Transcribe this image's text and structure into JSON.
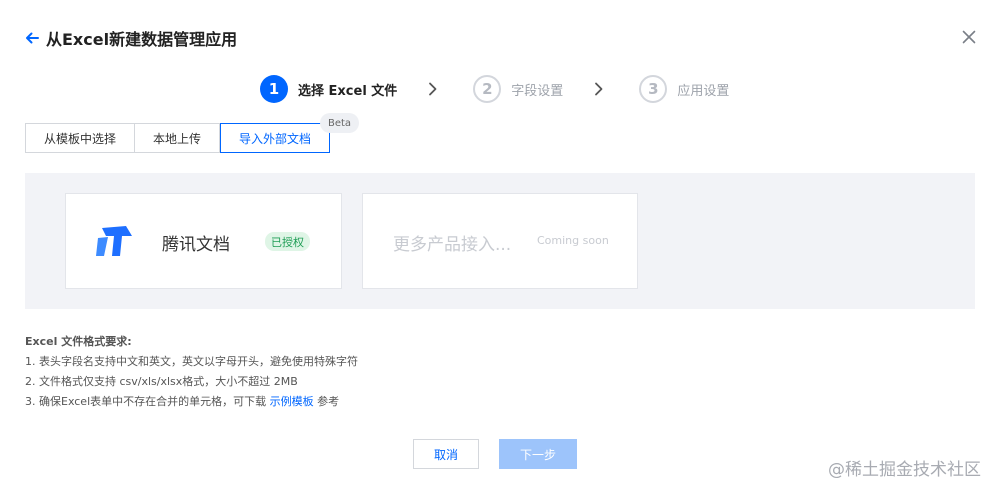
{
  "header": {
    "title": "从Excel新建数据管理应用"
  },
  "steps": [
    {
      "num": "1",
      "label": "选择 Excel 文件"
    },
    {
      "num": "2",
      "label": "字段设置"
    },
    {
      "num": "3",
      "label": "应用设置"
    }
  ],
  "tabs": [
    {
      "label": "从模板中选择"
    },
    {
      "label": "本地上传"
    },
    {
      "label": "导入外部文档"
    }
  ],
  "beta_badge": "Beta",
  "cards": {
    "tencent_docs": {
      "name": "腾讯文档",
      "badge": "已授权"
    },
    "more": {
      "text": "更多产品接入...",
      "note": "Coming soon"
    }
  },
  "requirements": {
    "title": "Excel 文件格式要求:",
    "item1": "1. 表头字段名支持中文和英文，英文以字母开头，避免使用特殊字符",
    "item2": "2. 文件格式仅支持 csv/xls/xlsx格式，大小不超过 2MB",
    "item3_prefix": "3. 确保Excel表单中不存在合并的单元格，可下载 ",
    "item3_link": "示例模板",
    "item3_suffix": " 参考"
  },
  "buttons": {
    "cancel": "取消",
    "next": "下一步"
  },
  "watermark": "@稀土掘金技术社区",
  "colors": {
    "accent": "#0066ff",
    "auth_green": "#1f9d55",
    "next_disabled": "#9dc4fb"
  }
}
